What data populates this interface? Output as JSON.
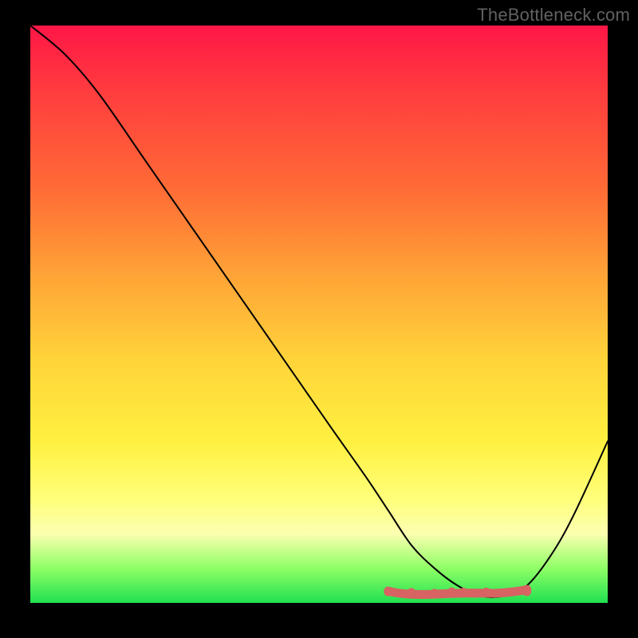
{
  "watermark": "TheBottleneck.com",
  "colors": {
    "curve": "#000000",
    "band": "#d76363",
    "dot": "#d76363"
  },
  "chart_data": {
    "type": "line",
    "title": "",
    "xlabel": "",
    "ylabel": "",
    "xlim": [
      0,
      100
    ],
    "ylim": [
      0,
      100
    ],
    "series": [
      {
        "name": "bottleneck-curve",
        "x": [
          0,
          6,
          12,
          20,
          28,
          36,
          44,
          52,
          58,
          62,
          66,
          70,
          74,
          78,
          82,
          86,
          90,
          94,
          100
        ],
        "y": [
          100,
          95,
          88,
          76.5,
          65,
          53.5,
          42,
          30.5,
          22,
          16,
          10,
          6,
          3,
          1.2,
          1.2,
          3,
          8,
          15,
          28
        ]
      }
    ],
    "flat_band": {
      "x_start": 62,
      "x_end": 86,
      "y": 1.8,
      "dots_x": [
        62,
        66,
        70,
        73,
        75,
        77,
        79,
        82,
        86
      ]
    }
  }
}
